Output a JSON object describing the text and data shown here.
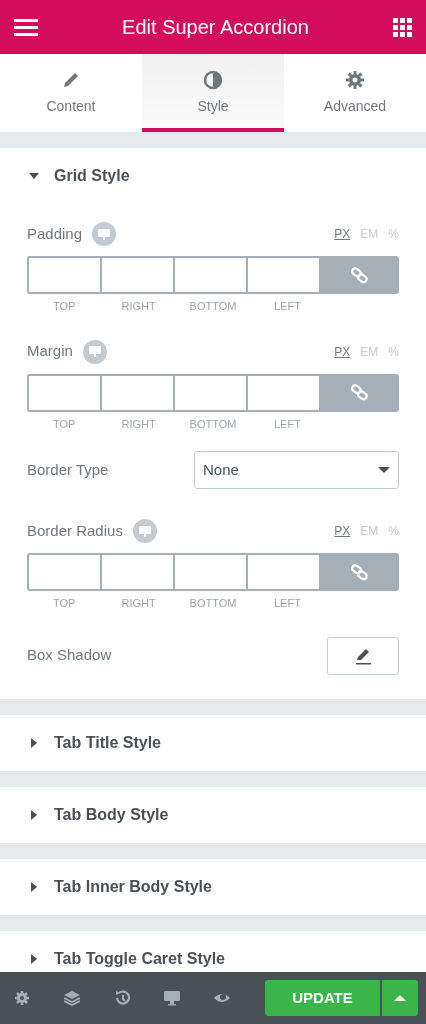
{
  "header": {
    "title": "Edit Super Accordion"
  },
  "tabs": [
    {
      "label": "Content",
      "selected": false
    },
    {
      "label": "Style",
      "selected": true
    },
    {
      "label": "Advanced",
      "selected": false
    }
  ],
  "sections": [
    {
      "title": "Grid Style",
      "expanded": true,
      "controls": [
        {
          "kind": "dimensions",
          "label": "Padding",
          "units": [
            {
              "label": "PX",
              "selected": true
            },
            {
              "label": "EM",
              "selected": false
            },
            {
              "label": "%",
              "selected": false
            }
          ],
          "fields": [
            "TOP",
            "RIGHT",
            "BOTTOM",
            "LEFT"
          ],
          "linked": true
        },
        {
          "kind": "dimensions",
          "label": "Margin",
          "units": [
            {
              "label": "PX",
              "selected": true
            },
            {
              "label": "EM",
              "selected": false
            },
            {
              "label": "%",
              "selected": false
            }
          ],
          "fields": [
            "TOP",
            "RIGHT",
            "BOTTOM",
            "LEFT"
          ],
          "linked": true
        },
        {
          "kind": "select",
          "label": "Border Type",
          "value": "None"
        },
        {
          "kind": "dimensions",
          "label": "Border Radius",
          "units": [
            {
              "label": "PX",
              "selected": true
            },
            {
              "label": "EM",
              "selected": false
            },
            {
              "label": "%",
              "selected": false
            }
          ],
          "fields": [
            "TOP",
            "RIGHT",
            "BOTTOM",
            "LEFT"
          ],
          "linked": true
        },
        {
          "kind": "popover",
          "label": "Box Shadow"
        }
      ]
    },
    {
      "title": "Tab Title Style",
      "expanded": false
    },
    {
      "title": "Tab Body Style",
      "expanded": false
    },
    {
      "title": "Tab Inner Body Style",
      "expanded": false
    },
    {
      "title": "Tab Toggle Caret Style",
      "expanded": false
    }
  ],
  "footer": {
    "button": "UPDATE"
  }
}
